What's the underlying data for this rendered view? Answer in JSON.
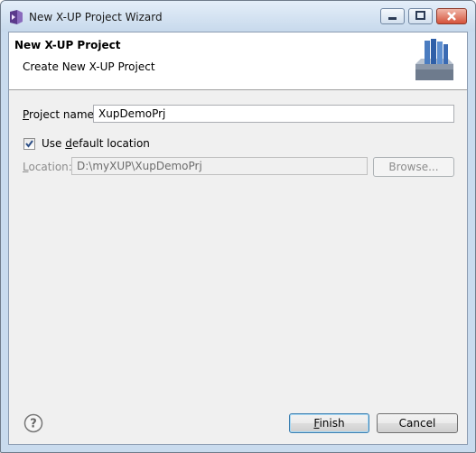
{
  "window": {
    "title": "New X-UP Project Wizard"
  },
  "banner": {
    "title": "New X-UP Project",
    "description": "Create New X-UP Project",
    "icon": "project-wizard-icon"
  },
  "project_name": {
    "label_accel": "P",
    "label_rest": "roject name:",
    "value": "XupDemoPrj"
  },
  "use_default": {
    "label_pre": "Use ",
    "label_accel": "d",
    "label_rest": "efault location",
    "checked": true
  },
  "location": {
    "label_accel": "L",
    "label_rest": "ocation:",
    "value": "D:\\myXUP\\XupDemoPrj",
    "browse_label": "Browse...",
    "enabled": false
  },
  "buttons": {
    "finish_accel": "F",
    "finish_rest": "inish",
    "cancel": "Cancel"
  },
  "icons": {
    "help": "help-icon",
    "minimize": "minimize-icon",
    "maximize": "maximize-icon",
    "close": "close-icon"
  }
}
